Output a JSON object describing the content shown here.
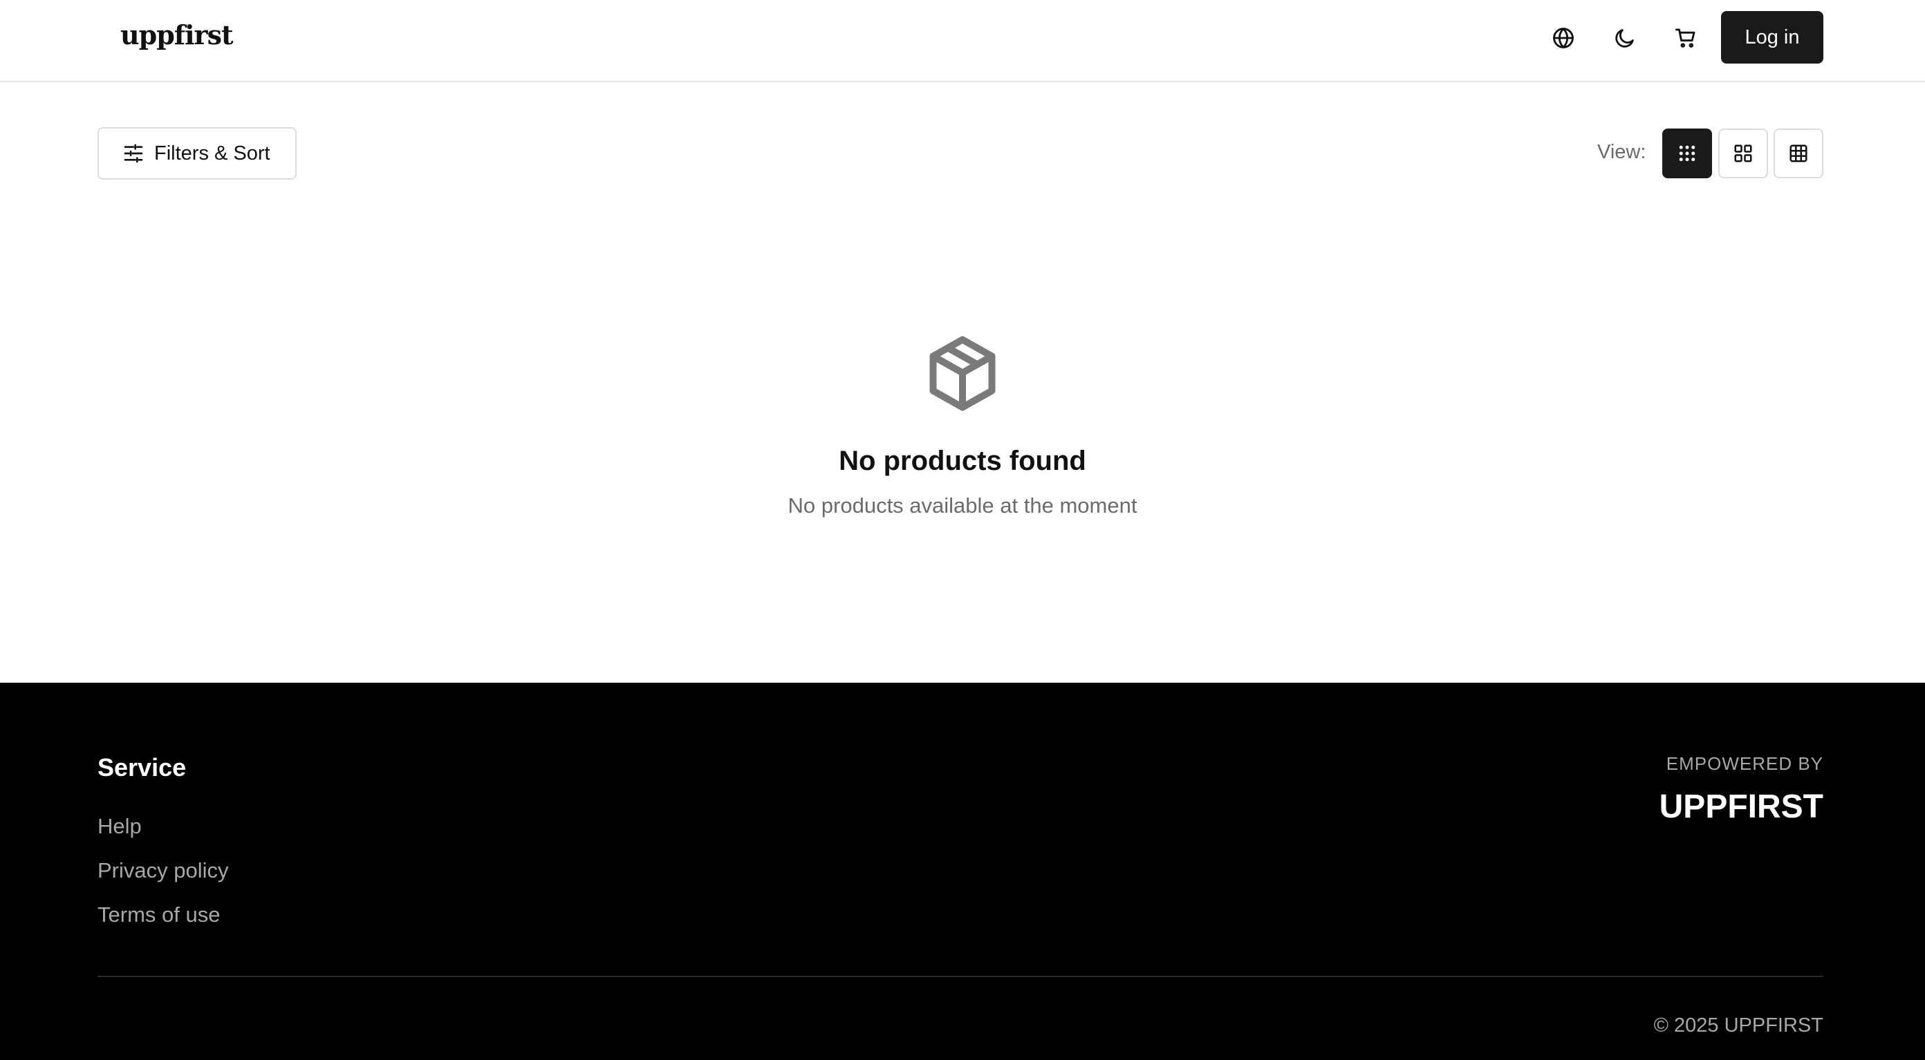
{
  "header": {
    "logo": "uppfirst",
    "icons": [
      "globe-icon",
      "moon-icon",
      "cart-icon"
    ],
    "login_label": "Log in"
  },
  "toolbar": {
    "filters_label": "Filters & Sort",
    "view_label": "View:",
    "view_modes": [
      "dots-grid",
      "large-grid",
      "table-grid"
    ],
    "active_view": "dots-grid"
  },
  "empty_state": {
    "icon": "box-icon",
    "title": "No products found",
    "subtitle": "No products available at the moment"
  },
  "footer": {
    "service_title": "Service",
    "links": [
      "Help",
      "Privacy policy",
      "Terms of use"
    ],
    "powered_by": "EMPOWERED BY",
    "brand": "UPPFIRST",
    "copyright": "© 2025 UPPFIRST"
  },
  "colors": {
    "primary_dark": "#1a1a1a",
    "footer_bg": "#000000",
    "muted_text": "#6b6b6b",
    "border": "#dcdcdc",
    "empty_icon": "#7a7a7a"
  }
}
